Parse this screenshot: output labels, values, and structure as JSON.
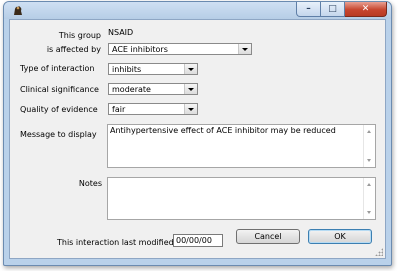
{
  "window": {
    "app_icon": "meerkat-app-icon",
    "controls": {
      "minimize": "–",
      "maximize": "□",
      "close": "✕"
    }
  },
  "form": {
    "this_group_label": "This group",
    "this_group_value": "NSAID",
    "affected_by_label": "is affected by",
    "affected_by_value": "ACE inhibitors",
    "type_label": "Type of interaction",
    "type_value": "inhibits",
    "clinical_label": "Clinical significance",
    "clinical_value": "moderate",
    "quality_label": "Quality of evidence",
    "quality_value": "fair",
    "message_label": "Message to display",
    "message_value": "Antihypertensive effect of ACE inhibitor may be reduced",
    "notes_label": "Notes",
    "notes_value": "",
    "modified_label": "This interaction last modified",
    "modified_value": "00/00/00"
  },
  "buttons": {
    "cancel": "Cancel",
    "ok": "OK"
  }
}
